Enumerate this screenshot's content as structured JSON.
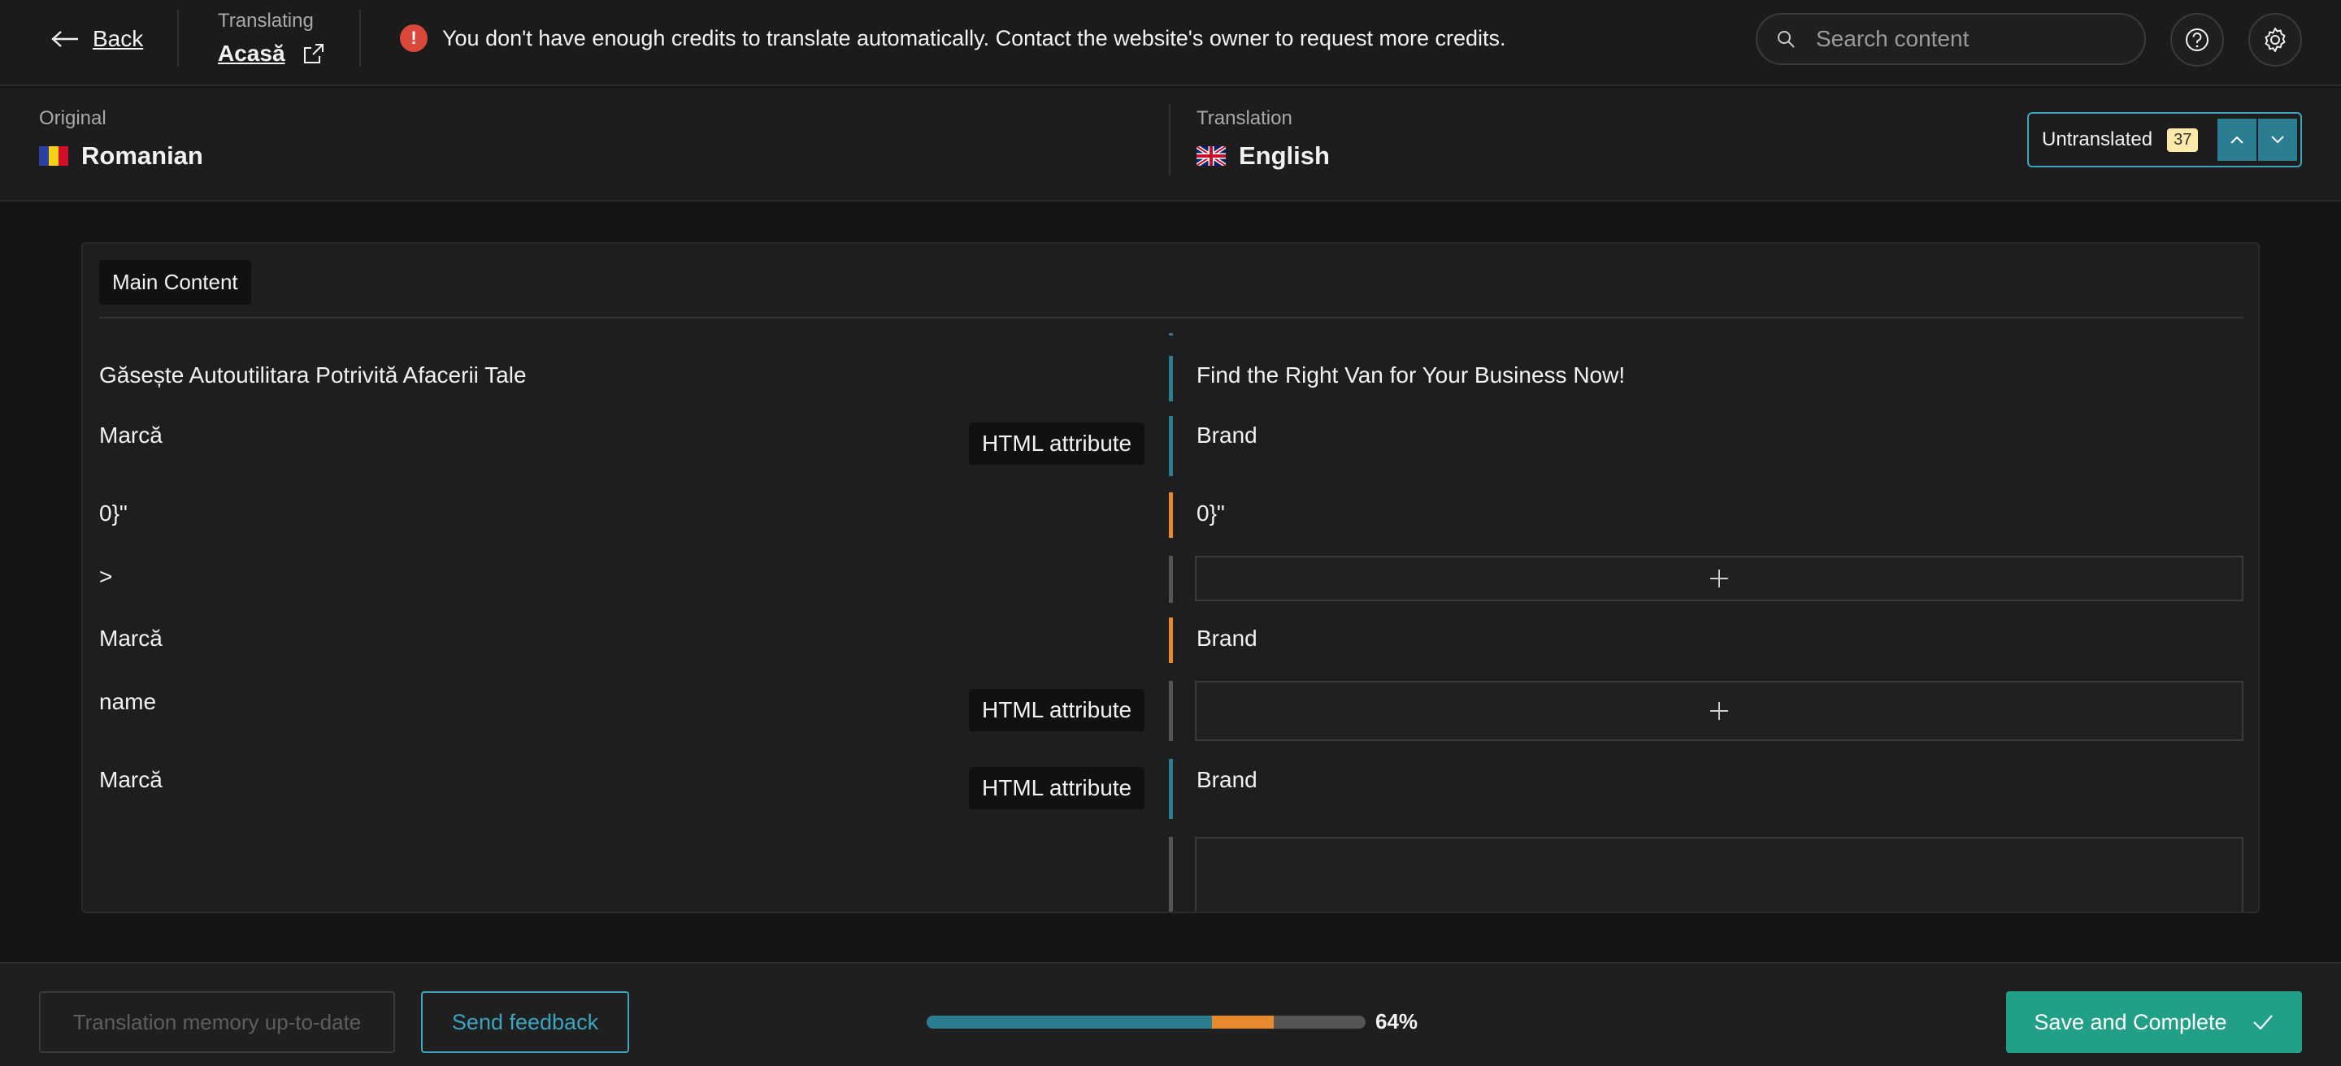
{
  "topbar": {
    "back_label": "Back",
    "translating_label": "Translating",
    "page_name": "Acasă",
    "alert_text": "You don't have enough credits to translate automatically. Contact the website's owner to request more credits.",
    "search_placeholder": "Search content"
  },
  "languages": {
    "original_label": "Original",
    "original_name": "Romanian",
    "translation_label": "Translation",
    "translation_name": "English",
    "filter_label": "Untranslated",
    "filter_count": "37"
  },
  "section": {
    "title": "Main Content",
    "rows": [
      {
        "original": "Găsește Autoutilitara Potrivită Afacerii Tale",
        "tag": "",
        "status": "translated",
        "translation": "Find the Right Van for Your Business Now!"
      },
      {
        "original": "Marcă",
        "tag": "HTML attribute",
        "status": "translated",
        "translation": "Brand"
      },
      {
        "original": "0}\"",
        "tag": "",
        "status": "partial",
        "translation": "0}\""
      },
      {
        "original": ">",
        "tag": "",
        "status": "empty",
        "translation": ""
      },
      {
        "original": "Marcă",
        "tag": "",
        "status": "partial",
        "translation": "Brand"
      },
      {
        "original": "name",
        "tag": "HTML attribute",
        "status": "empty",
        "translation": ""
      },
      {
        "original": "Marcă",
        "tag": "HTML attribute",
        "status": "translated",
        "translation": "Brand"
      }
    ]
  },
  "footer": {
    "memory_label": "Translation memory up-to-date",
    "feedback_label": "Send feedback",
    "progress_translated": 0.65,
    "progress_partial": 0.14,
    "progress_percent": "64%",
    "save_label": "Save and Complete"
  },
  "colors": {
    "accent": "#3ba5bf",
    "translated": "#2b7d92",
    "partial": "#e8892e",
    "empty": "#555555",
    "save": "#22a087",
    "alert": "#d9483b"
  }
}
